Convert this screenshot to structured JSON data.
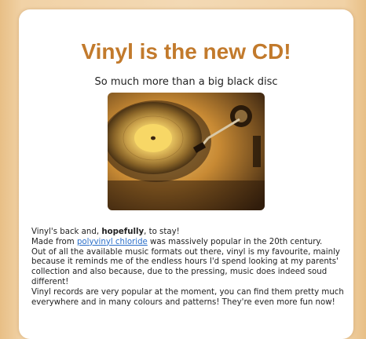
{
  "header": {
    "title": "Vinyl is the new CD!",
    "subtitle": "So much more than a big black disc"
  },
  "image": {
    "subject": "turntable-record-photo"
  },
  "article": {
    "p1_prefix": " Vinyl's back and, ",
    "p1_bold": "hopefully",
    "p1_suffix": ", to stay!",
    "p2_prefix": " Made from ",
    "p2_link": "polyvinyl chloride",
    "p2_suffix": " was massively popular in the 20th century.",
    "p3": " Out of all the available music formats out there, vinyl is my favourite, mainly because it reminds me of the endless hours I'd spend looking at my parents' collection and also because, due to the pressing, music does indeed soud different!",
    "p4": " Vinyl records are very popular at the moment, you can find them pretty much everywhere and in many colours and patterns! They're even more fun now!"
  },
  "colors": {
    "title": "#c27a2c",
    "link": "#2a6fc9",
    "background": "#f1d2a6"
  }
}
